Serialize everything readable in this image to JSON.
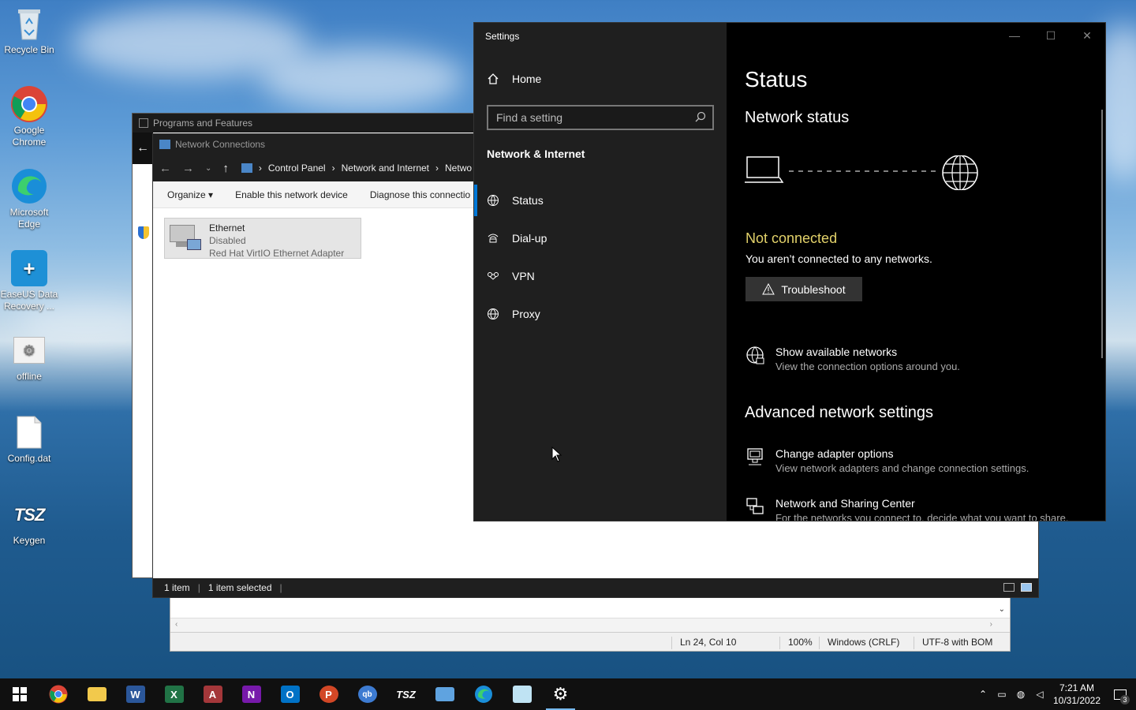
{
  "desktop": {
    "icons": [
      {
        "label": "Recycle Bin",
        "icon": "recycle-bin-icon"
      },
      {
        "label": "Google Chrome",
        "icon": "chrome-icon"
      },
      {
        "label": "Microsoft Edge",
        "icon": "edge-icon"
      },
      {
        "label": "EaseUS Data Recovery ...",
        "icon": "easeus-icon"
      },
      {
        "label": "offline",
        "icon": "offline-icon"
      },
      {
        "label": "Config.dat",
        "icon": "file-icon"
      },
      {
        "label": "Keygen",
        "icon": "keygen-icon"
      }
    ]
  },
  "programs_window": {
    "title": "Programs and Features"
  },
  "netconn_window": {
    "title": "Network Connections",
    "breadcrumb": [
      "Control Panel",
      "Network and Internet",
      "Netwo"
    ],
    "commands": [
      "Organize ▾",
      "Enable this network device",
      "Diagnose this connectio"
    ],
    "item": {
      "name": "Ethernet",
      "status": "Disabled",
      "adapter": "Red Hat VirtIO Ethernet Adapter"
    },
    "statusbar": {
      "count": "1 item",
      "selected": "1 item selected"
    }
  },
  "notepad": {
    "status": {
      "position": "Ln 24, Col 10",
      "zoom": "100%",
      "line_ending": "Windows (CRLF)",
      "encoding": "UTF-8 with BOM"
    }
  },
  "settings": {
    "app_title": "Settings",
    "home_label": "Home",
    "search_placeholder": "Find a setting",
    "section": "Network & Internet",
    "nav": [
      {
        "label": "Status",
        "icon": "status-icon",
        "active": true
      },
      {
        "label": "Dial-up",
        "icon": "dialup-icon",
        "active": false
      },
      {
        "label": "VPN",
        "icon": "vpn-icon",
        "active": false
      },
      {
        "label": "Proxy",
        "icon": "proxy-icon",
        "active": false
      }
    ],
    "page_title": "Status",
    "network_status_heading": "Network status",
    "connection_state": "Not connected",
    "connection_desc": "You aren’t connected to any networks.",
    "troubleshoot_label": "Troubleshoot",
    "show_networks": {
      "title": "Show available networks",
      "desc": "View the connection options around you."
    },
    "advanced_heading": "Advanced network settings",
    "adapter_options": {
      "title": "Change adapter options",
      "desc": "View network adapters and change connection settings."
    },
    "sharing_center": {
      "title": "Network and Sharing Center",
      "desc": "For the networks you connect to, decide what you want to share."
    },
    "status_color": "#e3d26a",
    "accent": "#0078d7"
  },
  "taskbar": {
    "apps": [
      "start-icon",
      "chrome-icon",
      "file-explorer-icon",
      "word-icon",
      "excel-icon",
      "access-icon",
      "onenote-icon",
      "outlook-icon",
      "powerpoint-icon",
      "qbittorrent-icon",
      "keygen-icon",
      "network-connections-icon",
      "edge-icon",
      "notepad-icon",
      "settings-icon"
    ],
    "time": "7:21 AM",
    "date": "10/31/2022",
    "notifications": "3"
  }
}
